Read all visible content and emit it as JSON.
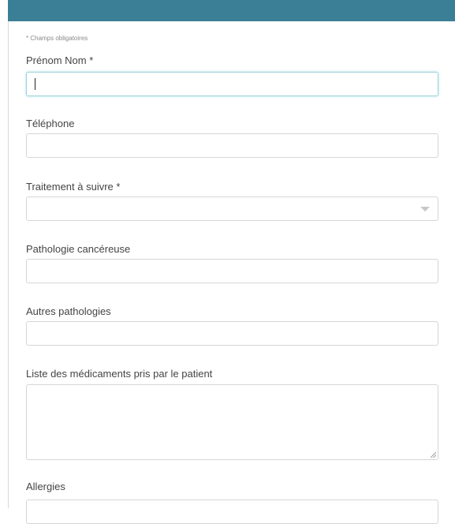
{
  "form": {
    "required_note": "* Champs obligatoires",
    "fields": {
      "name": {
        "label": "Prénom Nom *",
        "value": ""
      },
      "phone": {
        "label": "Téléphone",
        "value": ""
      },
      "treatment": {
        "label": "Traitement à suivre *",
        "selected": ""
      },
      "cancer_pathology": {
        "label": "Pathologie cancéreuse",
        "value": ""
      },
      "other_pathologies": {
        "label": "Autres pathologies",
        "value": ""
      },
      "medications": {
        "label": "Liste des médicaments pris par le patient",
        "value": ""
      },
      "allergies": {
        "label": "Allergies",
        "value": ""
      }
    }
  },
  "icons": {
    "select_arrow": "chevron-down-icon",
    "resize_grip": "resize-grip-icon"
  },
  "colors": {
    "header_bar": "#3a7f96",
    "focus_border": "#9fd3da",
    "field_border": "#d6d6d6",
    "label_text": "#444444"
  }
}
